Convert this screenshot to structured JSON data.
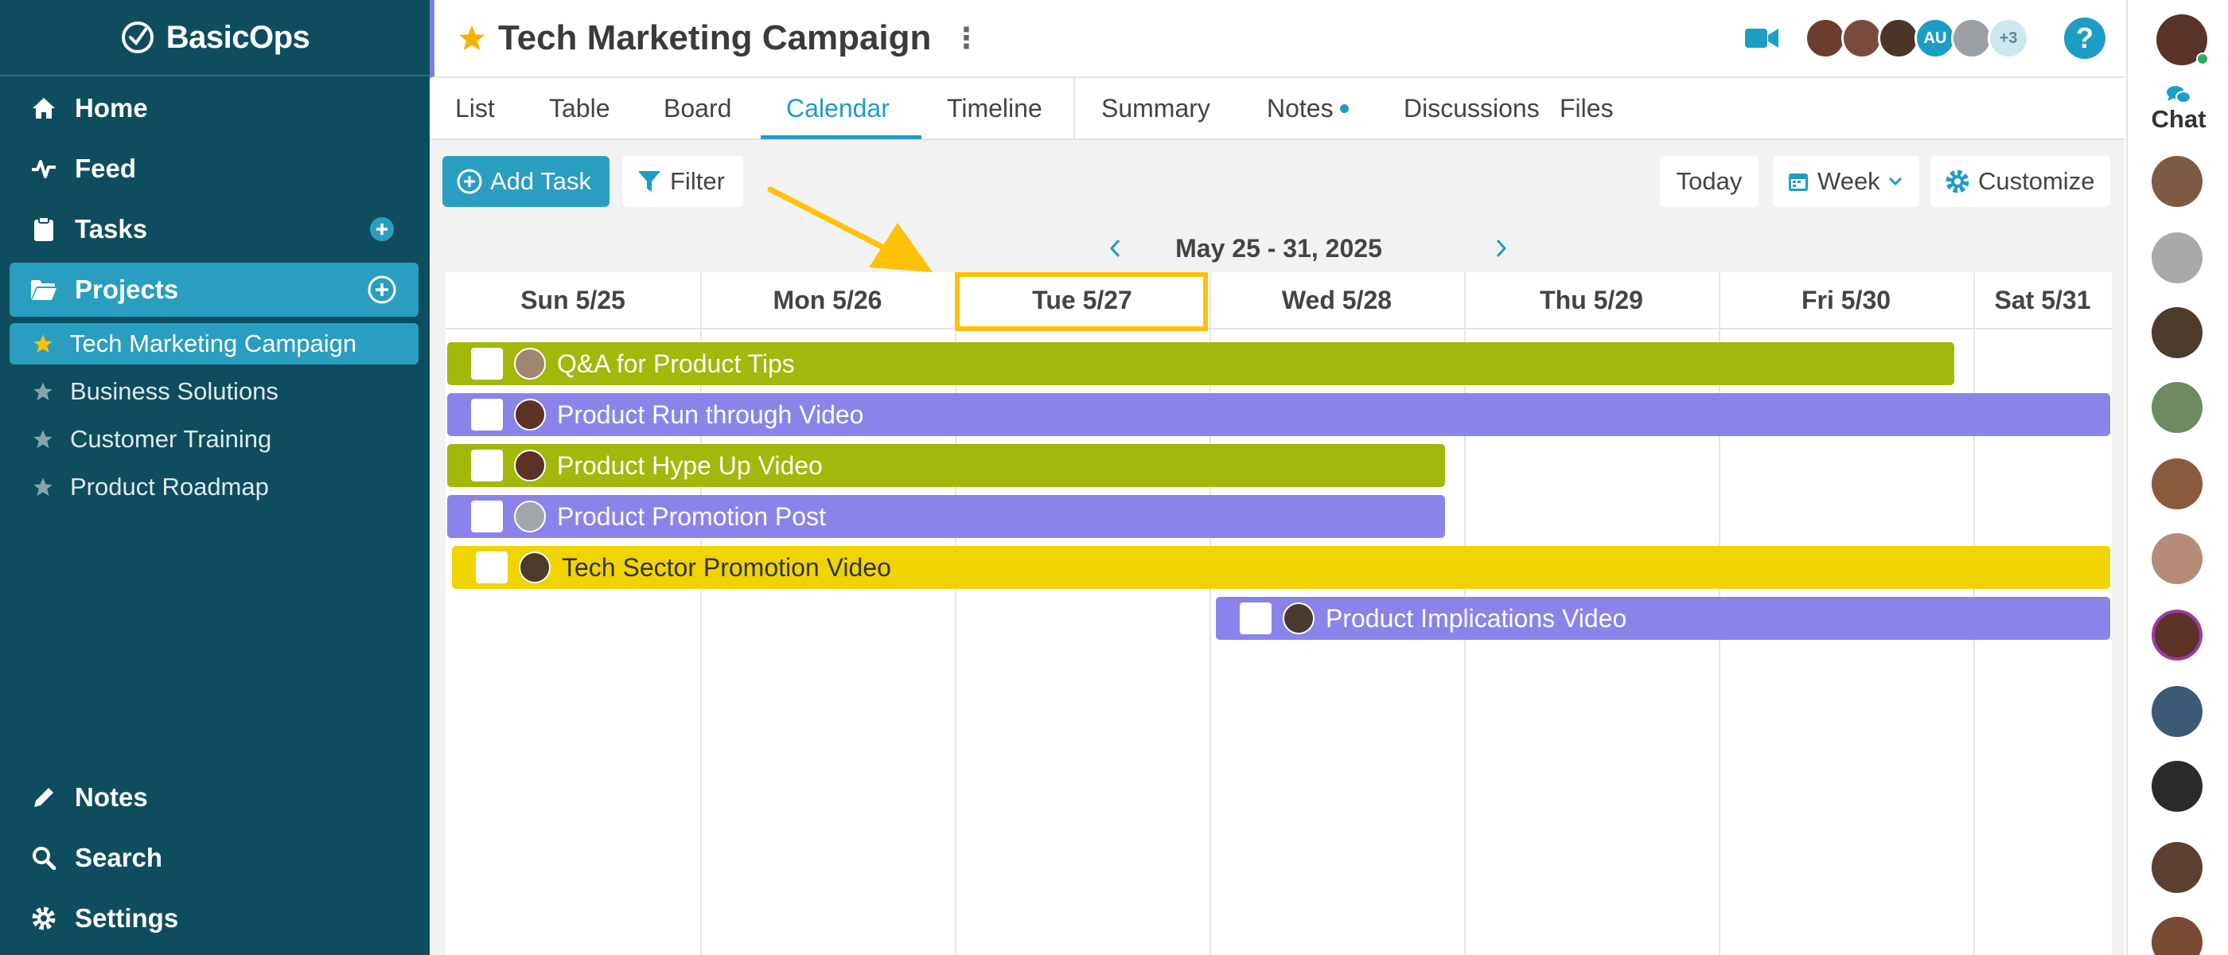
{
  "app": {
    "name": "BasicOps"
  },
  "sidebar": {
    "nav": [
      {
        "label": "Home",
        "icon": "home-icon"
      },
      {
        "label": "Feed",
        "icon": "pulse-icon"
      },
      {
        "label": "Tasks",
        "icon": "clipboard-icon"
      },
      {
        "label": "Projects",
        "icon": "folder-icon"
      }
    ],
    "projects": [
      {
        "label": "Tech Marketing Campaign",
        "active": true
      },
      {
        "label": "Business Solutions"
      },
      {
        "label": "Customer Training"
      },
      {
        "label": "Product Roadmap"
      }
    ],
    "bottom": [
      {
        "label": "Notes",
        "icon": "pencil-icon"
      },
      {
        "label": "Search",
        "icon": "search-icon"
      },
      {
        "label": "Settings",
        "icon": "gear-icon"
      }
    ]
  },
  "header": {
    "title": "Tech Marketing Campaign",
    "members_initials": "AU",
    "more_members": "+3",
    "help": "?"
  },
  "tabs": [
    "List",
    "Table",
    "Board",
    "Calendar",
    "Timeline",
    "Summary",
    "Notes",
    "Discussions",
    "Files"
  ],
  "active_tab": "Calendar",
  "toolbar": {
    "add_task": "Add Task",
    "filter": "Filter",
    "today": "Today",
    "week": "Week",
    "customize": "Customize"
  },
  "calendar": {
    "range": "May 25 - 31, 2025",
    "days": [
      "Sun 5/25",
      "Mon 5/26",
      "Tue 5/27",
      "Wed 5/28",
      "Thu 5/29",
      "Fri 5/30",
      "Sat 5/31"
    ],
    "today": "Tue 5/27",
    "tasks": [
      {
        "title": "Q&A for Product Tips",
        "color": "#a2b80a"
      },
      {
        "title": "Product Run through Video",
        "color": "#8a84ea"
      },
      {
        "title": "Product Hype Up Video",
        "color": "#a2b80a"
      },
      {
        "title": "Product Promotion Post",
        "color": "#8a84ea"
      },
      {
        "title": "Tech Sector Promotion Video",
        "color": "#f0d400"
      },
      {
        "title": "Product Implications Video",
        "color": "#8a84ea"
      }
    ]
  },
  "chat": {
    "label": "Chat"
  },
  "colors": {
    "sidebar": "#0e4d5e",
    "accent": "#2a9ec0",
    "highlight": "#ffc107"
  }
}
